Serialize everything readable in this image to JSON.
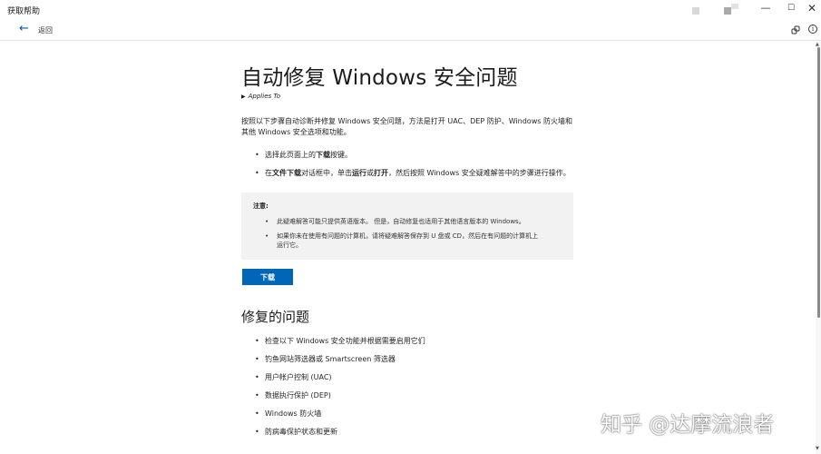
{
  "window": {
    "title": "获取帮助",
    "minimize": "—",
    "maximize": "☐",
    "close": "✕"
  },
  "nav": {
    "back_label": "返回"
  },
  "article": {
    "title": "自动修复 Windows 安全问题",
    "applies_to": "Applies To",
    "intro": "按照以下步骤自动诊断并修复 Windows 安全问题，方法是打开 UAC、DEP 防护、Windows 防火墙和其他 Windows 安全选项和功能。",
    "steps": [
      {
        "a": "选择此页面上的",
        "b": "下载",
        "c": "按键。"
      },
      {
        "a": "在",
        "b": "文件下载",
        "c": "对话框中，单击",
        "d": "运行",
        "e": "或",
        "f": "打开",
        "g": "，然后按照 Windows 安全疑难解答中的步骤进行操作。"
      }
    ],
    "note": {
      "title": "注意:",
      "items": [
        "此疑难解答可能只提供英语版本。 但是，自动修复也适用于其他语言版本的 Windows。",
        "如果你未在使用有问题的计算机，请将疑难解答保存到 U 盘或 CD，然后在有问题的计算机上运行它。"
      ]
    },
    "download_label": "下载",
    "section_title": "修复的问题",
    "fixes": [
      "检查以下 Windows 安全功能并根据需要启用它们",
      "钓鱼网站筛选器或 Smartscreen 筛选器",
      "用户帐户控制 (UAC)",
      "数据执行保护 (DEP)",
      "Windows 防火墙",
      "防病毒保护状态和更新"
    ]
  },
  "watermark": "知乎 @达摩流浪者",
  "colors": {
    "accent": "#0067b8",
    "note_bg": "#f2f2f2",
    "back_arrow": "#005fb8"
  },
  "icons": {
    "back": "back-arrow-icon",
    "share": "share-link-icon",
    "info": "info-icon"
  }
}
